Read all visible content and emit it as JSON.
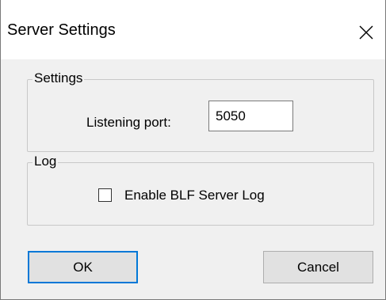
{
  "window": {
    "title": "Server Settings",
    "close_icon": "close-icon"
  },
  "settings_group": {
    "legend": "Settings",
    "port_label": "Listening port:",
    "port_value": "5050"
  },
  "log_group": {
    "legend": "Log",
    "checkbox_label": "Enable BLF Server Log",
    "checkbox_checked": false
  },
  "buttons": {
    "ok_label": "OK",
    "cancel_label": "Cancel"
  },
  "colors": {
    "dialog_background": "#f0f0f0",
    "titlebar_background": "#ffffff",
    "default_button_border": "#0078d7"
  }
}
